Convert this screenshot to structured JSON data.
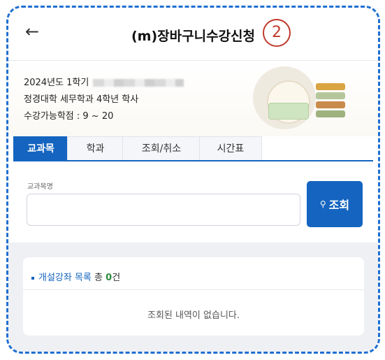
{
  "header": {
    "back_glyph": "←",
    "title": "(m)장바구니수강신청",
    "step": "2"
  },
  "info": {
    "line1": "2024년도 1학기",
    "line2": "정경대학 세무학과 4학년 학사",
    "line3": "수강가능학점 : 9 ~ 20"
  },
  "tabs": [
    {
      "label": "교과목",
      "active": true
    },
    {
      "label": "학과"
    },
    {
      "label": "조회/취소"
    },
    {
      "label": "시간표"
    }
  ],
  "search": {
    "label": "교과목명",
    "value": "",
    "button_icon": "search-icon",
    "button_label": "조회"
  },
  "list": {
    "title": "개설강좌 목록",
    "count_label": "총",
    "count": "0",
    "count_unit": "건",
    "empty_message": "조회된 내역이 없습니다."
  },
  "colors": {
    "accent": "#1565c0",
    "frame": "#1f6fd1",
    "step_circle": "#c0392b",
    "count": "#2e8b3e"
  }
}
